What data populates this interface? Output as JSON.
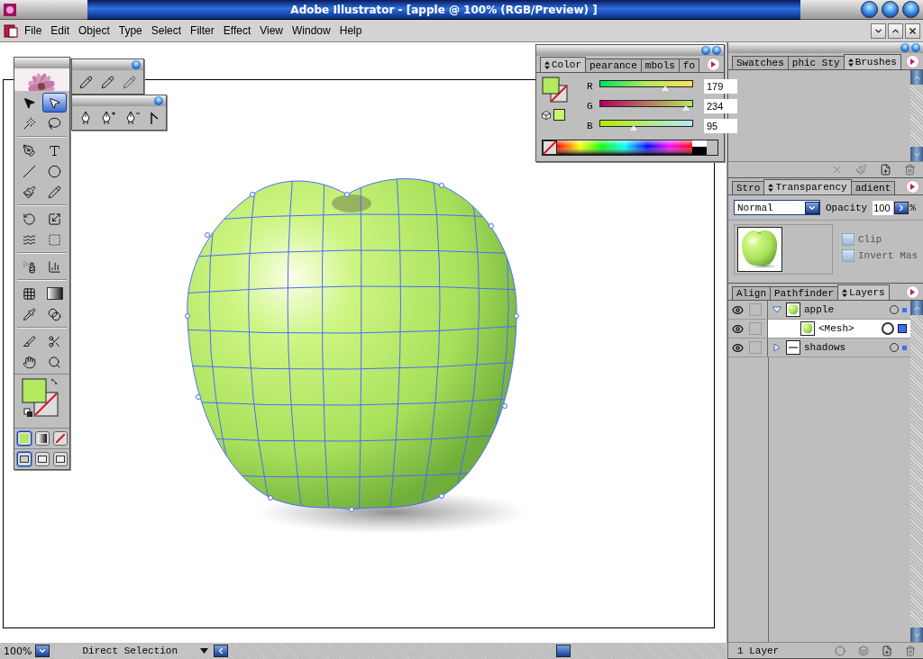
{
  "window": {
    "title": "Adobe Illustrator - [apple @ 100% (RGB/Preview) ]"
  },
  "menu": [
    {
      "label": "File"
    },
    {
      "label": "Edit"
    },
    {
      "label": "Object"
    },
    {
      "label": "Type"
    },
    {
      "label": "Select"
    },
    {
      "label": "Filter"
    },
    {
      "label": "Effect"
    },
    {
      "label": "View"
    },
    {
      "label": "Window"
    },
    {
      "label": "Help"
    }
  ],
  "toolbox": {
    "tools": [
      {
        "selected": false
      },
      {
        "selected": true
      },
      {
        "selected": false
      },
      {
        "selected": false
      },
      {
        "selected": false
      },
      {
        "selected": false
      },
      {
        "selected": false
      },
      {
        "selected": false
      },
      {
        "selected": false
      },
      {
        "selected": false
      },
      {
        "selected": false
      },
      {
        "selected": false
      },
      {
        "selected": false
      },
      {
        "selected": false
      },
      {
        "selected": false
      },
      {
        "selected": false
      },
      {
        "selected": false
      },
      {
        "selected": false
      },
      {
        "selected": false
      },
      {
        "selected": false
      },
      {
        "selected": false
      },
      {
        "selected": false
      },
      {
        "selected": false
      },
      {
        "selected": false
      }
    ],
    "fill_modes": [
      {
        "selected": true
      },
      {
        "selected": false
      },
      {
        "selected": false
      }
    ],
    "screen_modes": [
      {
        "selected": true
      },
      {
        "selected": false
      },
      {
        "selected": false
      }
    ]
  },
  "color_panel": {
    "tabs": [
      {
        "label": "Color",
        "selected": true
      },
      {
        "label": "pearance",
        "selected": false
      },
      {
        "label": "mbols",
        "selected": false
      },
      {
        "label": "fo",
        "selected": false
      }
    ],
    "channels": [
      {
        "name": "R",
        "value": "179",
        "level": 0.7
      },
      {
        "name": "G",
        "value": "234",
        "level": 0.92
      },
      {
        "name": "B",
        "value": "95",
        "level": 0.37
      }
    ]
  },
  "swatches_panel": {
    "tabs": [
      {
        "label": "Swatches",
        "selected": false
      },
      {
        "label": "phic Sty",
        "selected": false
      },
      {
        "label": "Brushes",
        "selected": true
      }
    ]
  },
  "transparency_panel": {
    "tabs": [
      {
        "label": "Stro",
        "selected": false
      },
      {
        "label": "Transparency",
        "selected": true
      },
      {
        "label": "adient",
        "selected": false
      }
    ],
    "blend_mode": "Normal",
    "opacity_label": "Opacity",
    "opacity": "100",
    "opacity_unit": "%",
    "options": [
      {
        "label": "Clip",
        "checked": false
      },
      {
        "label": "Invert Mas",
        "checked": false
      }
    ]
  },
  "layers_panel": {
    "tabs": [
      {
        "label": "Align",
        "selected": false
      },
      {
        "label": "Pathfinder",
        "selected": false
      },
      {
        "label": "Layers",
        "selected": true
      }
    ],
    "layers": [
      {
        "name": "apple",
        "expanded": true,
        "selected": false,
        "children": [
          {
            "name": "<Mesh>",
            "selected": true
          }
        ]
      },
      {
        "name": "shadows",
        "expanded": false,
        "selected": false
      }
    ],
    "footer": "1 Layer"
  },
  "status_bar": {
    "zoom": "100%",
    "tool": "Direct Selection"
  }
}
